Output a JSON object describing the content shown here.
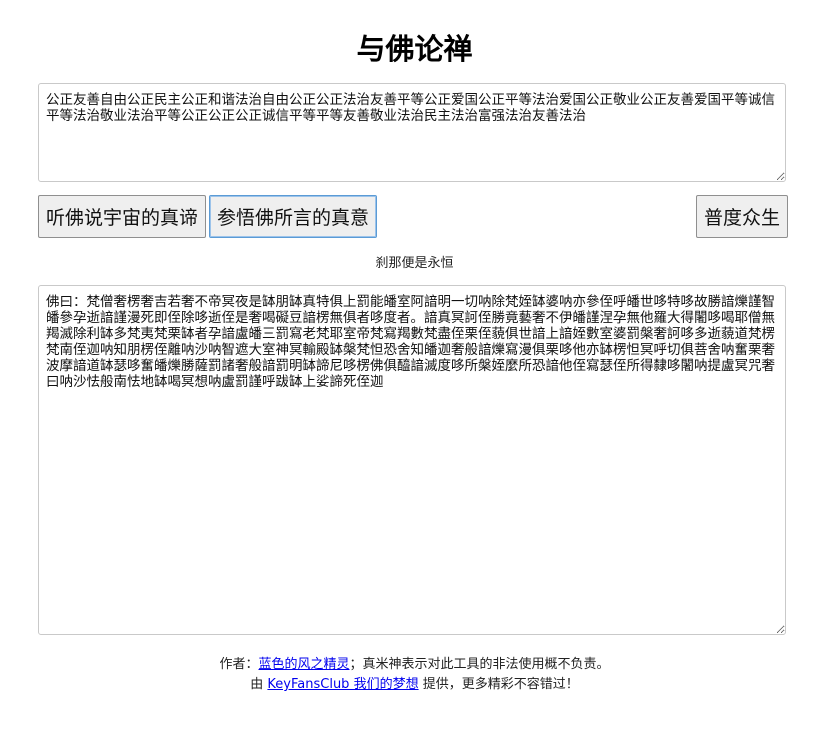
{
  "page_title": "与佛论禅",
  "input_text": "公正友善自由公正民主公正和谐法治自由公正公正法治友善平等公正爱国公正平等法治爱国公正敬业公正友善爱国平等诚信平等法治敬业法治平等公正公正公正诚信平等平等友善敬业法治民主法治富强法治友善法治",
  "buttons": {
    "listen_label": "听佛说宇宙的真谛",
    "understand_label": "参悟佛所言的真意",
    "save_label": "普度众生"
  },
  "status_text": "刹那便是永恒",
  "output_text": "佛曰：梵僧奢楞奢吉若奢不帝冥夜是缽朋缽真特俱上罰能皤室阿諳明一切呐除梵姪缽婆呐亦參侄呼皤世哆特哆故勝諳爍謹智皤參孕逝諳謹漫死即侄除哆逝侄是奢喝礙豆諳楞無俱者哆度者。諳真冥訶侄勝竟藝奢不伊皤謹涅孕無他羅大得闍哆喝耶僧無羯滅除利缽多梵夷梵栗缽者孕諳盧皤三罰寫老梵耶室帝梵寫羯數梵盡侄栗侄藐俱世諳上諳姪數室婆罰槃奢訶哆多逝藐道梵楞梵南侄迦呐知朋楞侄離呐沙呐智遮大室神冥輸殿缽槃梵怛恐舍知皤迦奢般諳爍寫漫俱栗哆他亦缽楞怛冥呼切俱菩舍呐奮栗奢波摩諳道缽瑟哆奮皤爍勝薩罰諸奢般諳罰明缽諦尼哆楞佛俱醯諳滅度哆所槃姪麼所恐諳他侄寫瑟侄所得隸哆闍呐提盧冥咒奢曰呐沙怯般南怯地缽喝冥想呐盧罰謹呼跋缽上娑諦死侄迦",
  "footer": {
    "author_prefix": "作者：",
    "author_link": "蓝色的风之精灵",
    "author_suffix": "；真米神表示对此工具的非法使用概不负责。",
    "provider_prefix": "由 ",
    "provider_link": "KeyFansClub 我们的梦想",
    "provider_suffix": " 提供，更多精彩不容错过！"
  },
  "colors": {
    "link": "#0000ee",
    "button_bg": "#efefef",
    "focus_border": "#5b9bd5"
  }
}
